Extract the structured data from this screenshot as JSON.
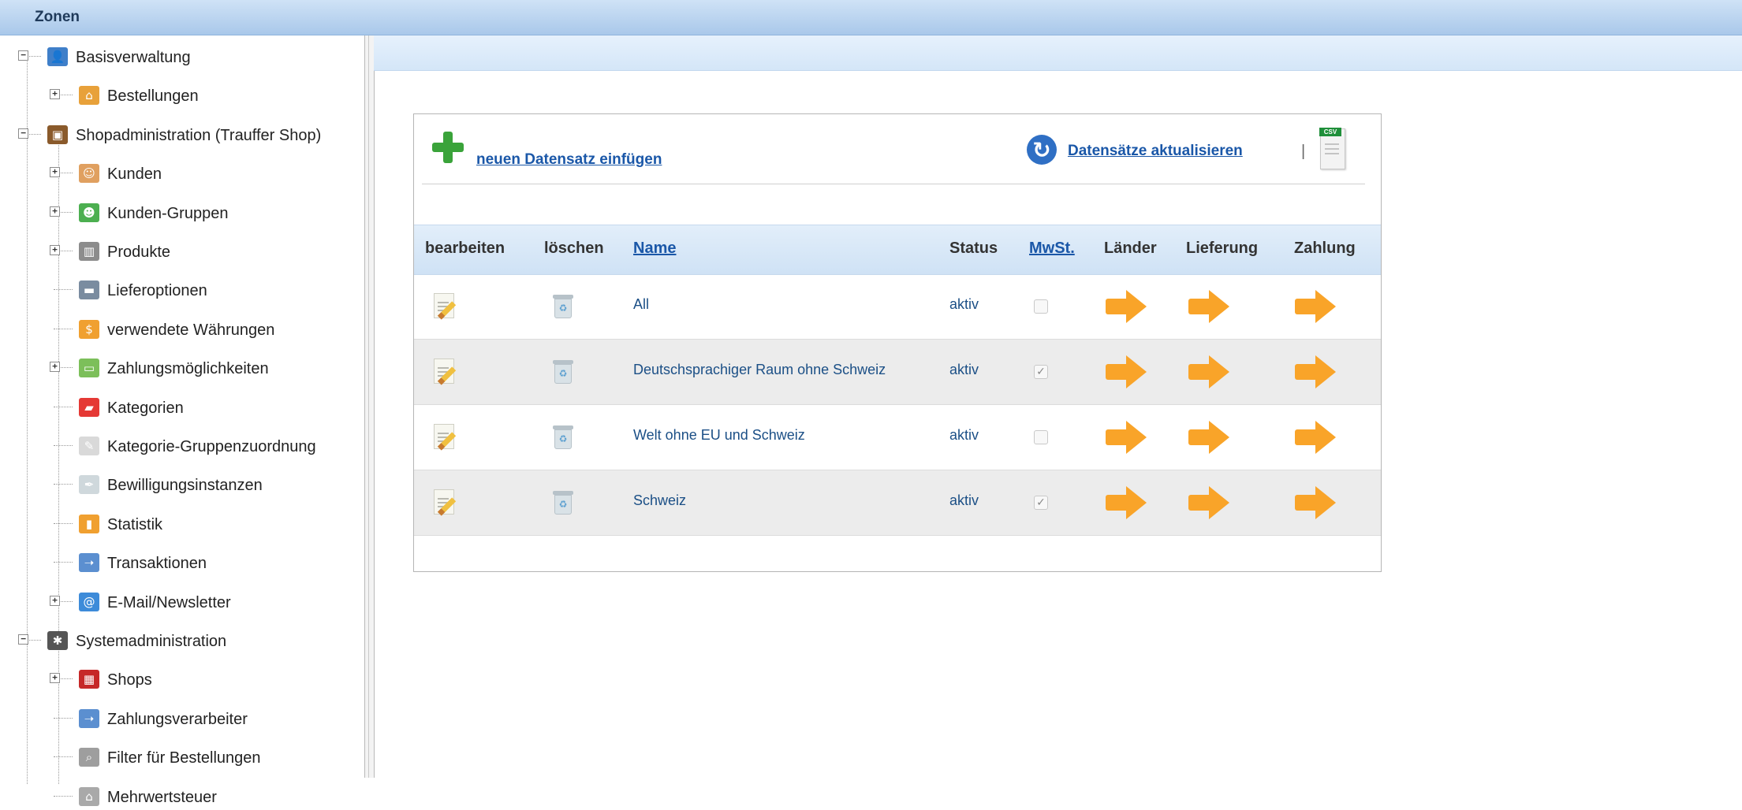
{
  "window": {
    "title": "Zonen"
  },
  "sidebar": {
    "items": [
      {
        "label": "Basisverwaltung",
        "icon": "user-admin-icon",
        "level": 0,
        "expander": "minus"
      },
      {
        "label": "Bestellungen",
        "icon": "basket-icon",
        "level": 1,
        "expander": "plus"
      },
      {
        "label": "Shopadministration (Trauffer Shop)",
        "icon": "briefcase-icon",
        "level": 0,
        "expander": "minus"
      },
      {
        "label": "Kunden",
        "icon": "customer-icon",
        "level": 1,
        "expander": "plus"
      },
      {
        "label": "Kunden-Gruppen",
        "icon": "user-group-icon",
        "level": 1,
        "expander": "plus"
      },
      {
        "label": "Produkte",
        "icon": "books-icon",
        "level": 1,
        "expander": "plus"
      },
      {
        "label": "Lieferoptionen",
        "icon": "truck-icon",
        "level": 1,
        "expander": "none"
      },
      {
        "label": "verwendete Währungen",
        "icon": "coin-icon",
        "level": 1,
        "expander": "none"
      },
      {
        "label": "Zahlungsmöglichkeiten",
        "icon": "banknote-icon",
        "level": 1,
        "expander": "plus"
      },
      {
        "label": "Kategorien",
        "icon": "shopping-bag-icon",
        "level": 1,
        "expander": "none"
      },
      {
        "label": "Kategorie-Gruppenzuordnung",
        "icon": "document-link-icon",
        "level": 1,
        "expander": "none"
      },
      {
        "label": "Bewilligungsinstanzen",
        "icon": "pen-icon",
        "level": 1,
        "expander": "none"
      },
      {
        "label": "Statistik",
        "icon": "bar-chart-icon",
        "level": 1,
        "expander": "none"
      },
      {
        "label": "Transaktionen",
        "icon": "transaction-icon",
        "level": 1,
        "expander": "none"
      },
      {
        "label": "E-Mail/Newsletter",
        "icon": "at-icon",
        "level": 1,
        "expander": "plus"
      },
      {
        "label": "Systemadministration",
        "icon": "gears-icon",
        "level": 0,
        "expander": "minus"
      },
      {
        "label": "Shops",
        "icon": "shop-icon",
        "level": 1,
        "expander": "plus"
      },
      {
        "label": "Zahlungsverarbeiter",
        "icon": "transaction-icon",
        "level": 1,
        "expander": "none"
      },
      {
        "label": "Filter für Bestellungen",
        "icon": "filter-icon",
        "level": 1,
        "expander": "none"
      },
      {
        "label": "Mehrwertsteuer",
        "icon": "bank-icon",
        "level": 1,
        "expander": "none"
      }
    ]
  },
  "toolbar": {
    "new_record": "neuen Datensatz einfügen",
    "refresh": "Datensätze aktualisieren",
    "separator": "|",
    "csv_icon": "csv-export-icon",
    "csv_tag": "CSV"
  },
  "table": {
    "columns": [
      "bearbeiten",
      "löschen",
      "Name",
      "Status",
      "MwSt.",
      "Länder",
      "Lieferung",
      "Zahlung"
    ],
    "rows": [
      {
        "name": "All",
        "status": "aktiv",
        "mwst": false
      },
      {
        "name": "Deutschsprachiger Raum ohne Schweiz",
        "status": "aktiv",
        "mwst": true
      },
      {
        "name": "Welt ohne EU und Schweiz",
        "status": "aktiv",
        "mwst": false
      },
      {
        "name": "Schweiz",
        "status": "aktiv",
        "mwst": true
      }
    ]
  },
  "colors": {
    "accent_link": "#1a57a8",
    "header_band": "#cfe2f6",
    "arrow": "#f9a429",
    "add_green": "#3aa33a"
  }
}
